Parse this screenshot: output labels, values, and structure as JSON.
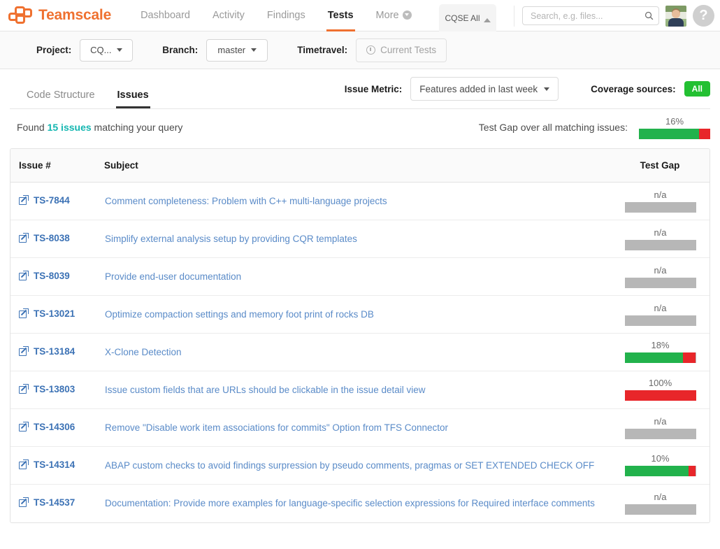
{
  "header": {
    "brand": "Teamscale",
    "nav": [
      {
        "label": "Dashboard",
        "active": false
      },
      {
        "label": "Activity",
        "active": false
      },
      {
        "label": "Findings",
        "active": false
      },
      {
        "label": "Tests",
        "active": true
      },
      {
        "label": "More",
        "active": false
      }
    ],
    "context_tab": "CQSE All",
    "search_placeholder": "Search, e.g. files...",
    "search_value": "",
    "help_glyph": "?"
  },
  "projectbar": {
    "project_label": "Project:",
    "project_value": "CQ...",
    "branch_label": "Branch:",
    "branch_value": "master",
    "timetravel_label": "Timetravel:",
    "timetravel_value": "Current Tests"
  },
  "subnav": {
    "tabs": [
      {
        "label": "Code Structure",
        "active": false
      },
      {
        "label": "Issues",
        "active": true
      }
    ],
    "issue_metric_label": "Issue Metric:",
    "issue_metric_value": "Features added in last week",
    "coverage_sources_label": "Coverage sources:",
    "coverage_sources_value": "All"
  },
  "summary": {
    "found_prefix": "Found ",
    "found_count": "15 issues",
    "found_suffix": " matching your query",
    "testgap_label": "Test Gap over all matching issues:",
    "testgap_percent_text": "16%",
    "testgap_percent": 16
  },
  "table": {
    "columns": [
      "Issue #",
      "Subject",
      "Test Gap"
    ],
    "rows": [
      {
        "id": "TS-7844",
        "subject": "Comment completeness: Problem with C++ multi-language projects",
        "gap_text": "n/a",
        "gap": null
      },
      {
        "id": "TS-8038",
        "subject": "Simplify external analysis setup by providing CQR templates",
        "gap_text": "n/a",
        "gap": null
      },
      {
        "id": "TS-8039",
        "subject": "Provide end-user documentation",
        "gap_text": "n/a",
        "gap": null
      },
      {
        "id": "TS-13021",
        "subject": "Optimize compaction settings and memory foot print of rocks DB",
        "gap_text": "n/a",
        "gap": null
      },
      {
        "id": "TS-13184",
        "subject": "X-Clone Detection",
        "gap_text": "18%",
        "gap": 18
      },
      {
        "id": "TS-13803",
        "subject": "Issue custom fields that are URLs should be clickable in the issue detail view",
        "gap_text": "100%",
        "gap": 100
      },
      {
        "id": "TS-14306",
        "subject": "Remove \"Disable work item associations for commits\" Option from TFS Connector",
        "gap_text": "n/a",
        "gap": null
      },
      {
        "id": "TS-14314",
        "subject": "ABAP custom checks to avoid findings surpression by pseudo comments, pragmas or SET EXTENDED CHECK OFF",
        "gap_text": "10%",
        "gap": 10
      },
      {
        "id": "TS-14537",
        "subject": "Documentation: Provide more examples for language-specific selection expressions for Required interface comments",
        "gap_text": "n/a",
        "gap": null
      }
    ]
  },
  "colors": {
    "brand_orange": "#ef7130",
    "link_blue": "#3c72b5",
    "teal": "#13b6b0",
    "green": "#22b24c",
    "red": "#e8262a",
    "gray_bar": "#b7b7b7"
  }
}
